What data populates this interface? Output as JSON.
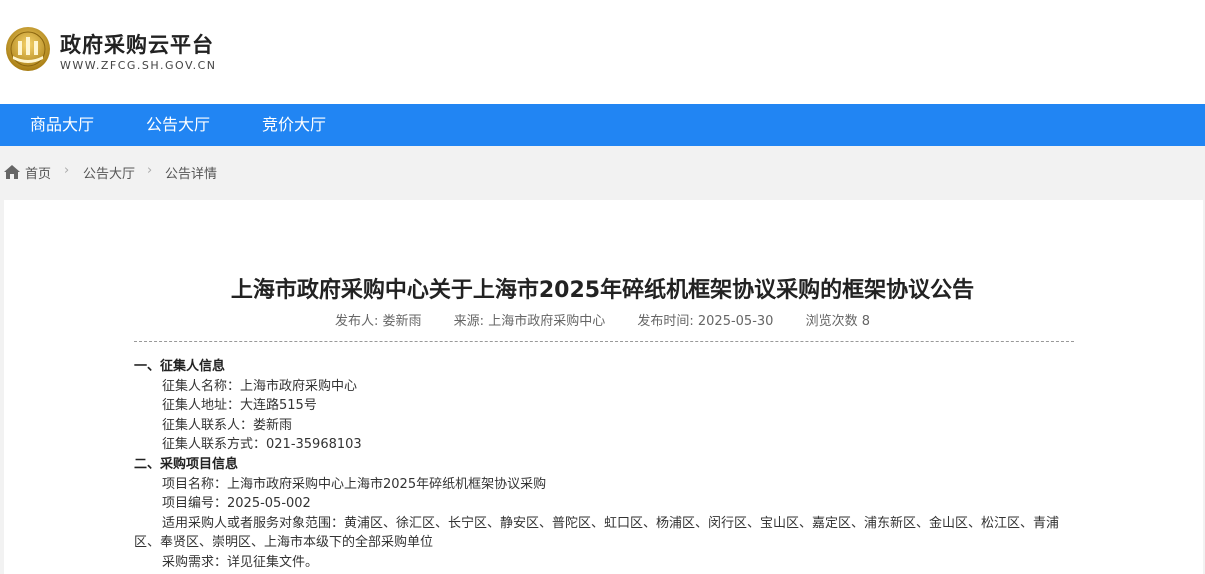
{
  "header": {
    "title": "政府采购云平台",
    "url": "WWW.ZFCG.SH.GOV.CN",
    "colors": {
      "nav_bg": "#2185f3",
      "emblem_gold": "#c9a227"
    }
  },
  "nav": {
    "items": [
      {
        "label": "商品大厅"
      },
      {
        "label": "公告大厅"
      },
      {
        "label": "竞价大厅"
      }
    ]
  },
  "breadcrumb": {
    "icon": "home-icon",
    "items": [
      "首页",
      "公告大厅",
      "公告详情"
    ]
  },
  "article": {
    "title": "上海市政府采购中心关于上海市2025年碎纸机框架协议采购的框架协议公告",
    "meta": {
      "publisher_label": "发布人:",
      "publisher": "娄新雨",
      "source_label": "来源:",
      "source": "上海市政府采购中心",
      "date_label": "发布时间:",
      "date": "2025-05-30",
      "views_label": "浏览次数",
      "views": "8"
    },
    "sections": [
      {
        "heading": "一、征集人信息",
        "lines": [
          "征集人名称：上海市政府采购中心",
          "征集人地址：大连路515号",
          "征集人联系人：娄新雨",
          "征集人联系方式：021-35968103"
        ]
      },
      {
        "heading": "二、采购项目信息",
        "lines": [
          "项目名称：上海市政府采购中心上海市2025年碎纸机框架协议采购",
          "项目编号：2025-05-002",
          "适用采购人或者服务对象范围：黄浦区、徐汇区、长宁区、静安区、普陀区、虹口区、杨浦区、闵行区、宝山区、嘉定区、浦东新区、金山区、松江区、青浦区、奉贤区、崇明区、上海市本级下的全部采购单位",
          "采购需求：详见征集文件。"
        ]
      }
    ]
  }
}
